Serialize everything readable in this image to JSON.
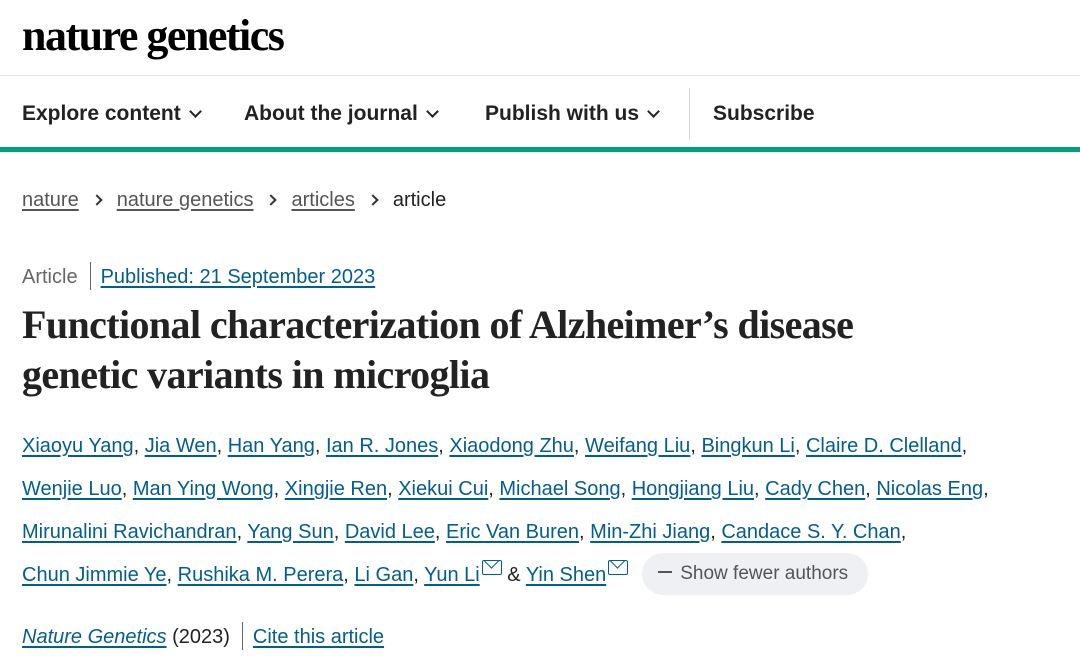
{
  "header": {
    "logo": "nature genetics"
  },
  "nav": {
    "items": [
      {
        "label": "Explore content",
        "has_dropdown": true
      },
      {
        "label": "About the journal",
        "has_dropdown": true
      },
      {
        "label": "Publish with us",
        "has_dropdown": true
      },
      {
        "label": "Subscribe",
        "has_dropdown": false
      }
    ]
  },
  "breadcrumb": {
    "items": [
      "nature",
      "nature genetics",
      "articles"
    ],
    "current": "article"
  },
  "article": {
    "type": "Article",
    "published": "Published: 21 September 2023",
    "title_line1": "Functional characterization of Alzheimer’s disease",
    "title_line2": "genetic variants in microglia",
    "authors": [
      "Xiaoyu Yang",
      "Jia Wen",
      "Han Yang",
      "Ian R. Jones",
      "Xiaodong Zhu",
      "Weifang Liu",
      "Bingkun Li",
      "Claire D. Clelland",
      "Wenjie Luo",
      "Man Ying Wong",
      "Xingjie Ren",
      "Xiekui Cui",
      "Michael Song",
      "Hongjiang Liu",
      "Cady Chen",
      "Nicolas Eng",
      "Mirunalini Ravichandran",
      "Yang Sun",
      "David Lee",
      "Eric Van Buren",
      "Min-Zhi Jiang",
      "Candace S. Y. Chan",
      "Chun Jimmie Ye",
      "Rushika M. Perera",
      "Li Gan",
      "Yun Li",
      "Yin Shen"
    ],
    "corresponding_authors": [
      "Yun Li",
      "Yin Shen"
    ],
    "show_fewer_label": "Show fewer authors",
    "journal": "Nature Genetics",
    "year": "(2023)",
    "cite_label": "Cite this article"
  },
  "colors": {
    "link": "#025e8d",
    "accent_bar": "#00a07a",
    "button_bg": "#eff0f3"
  }
}
